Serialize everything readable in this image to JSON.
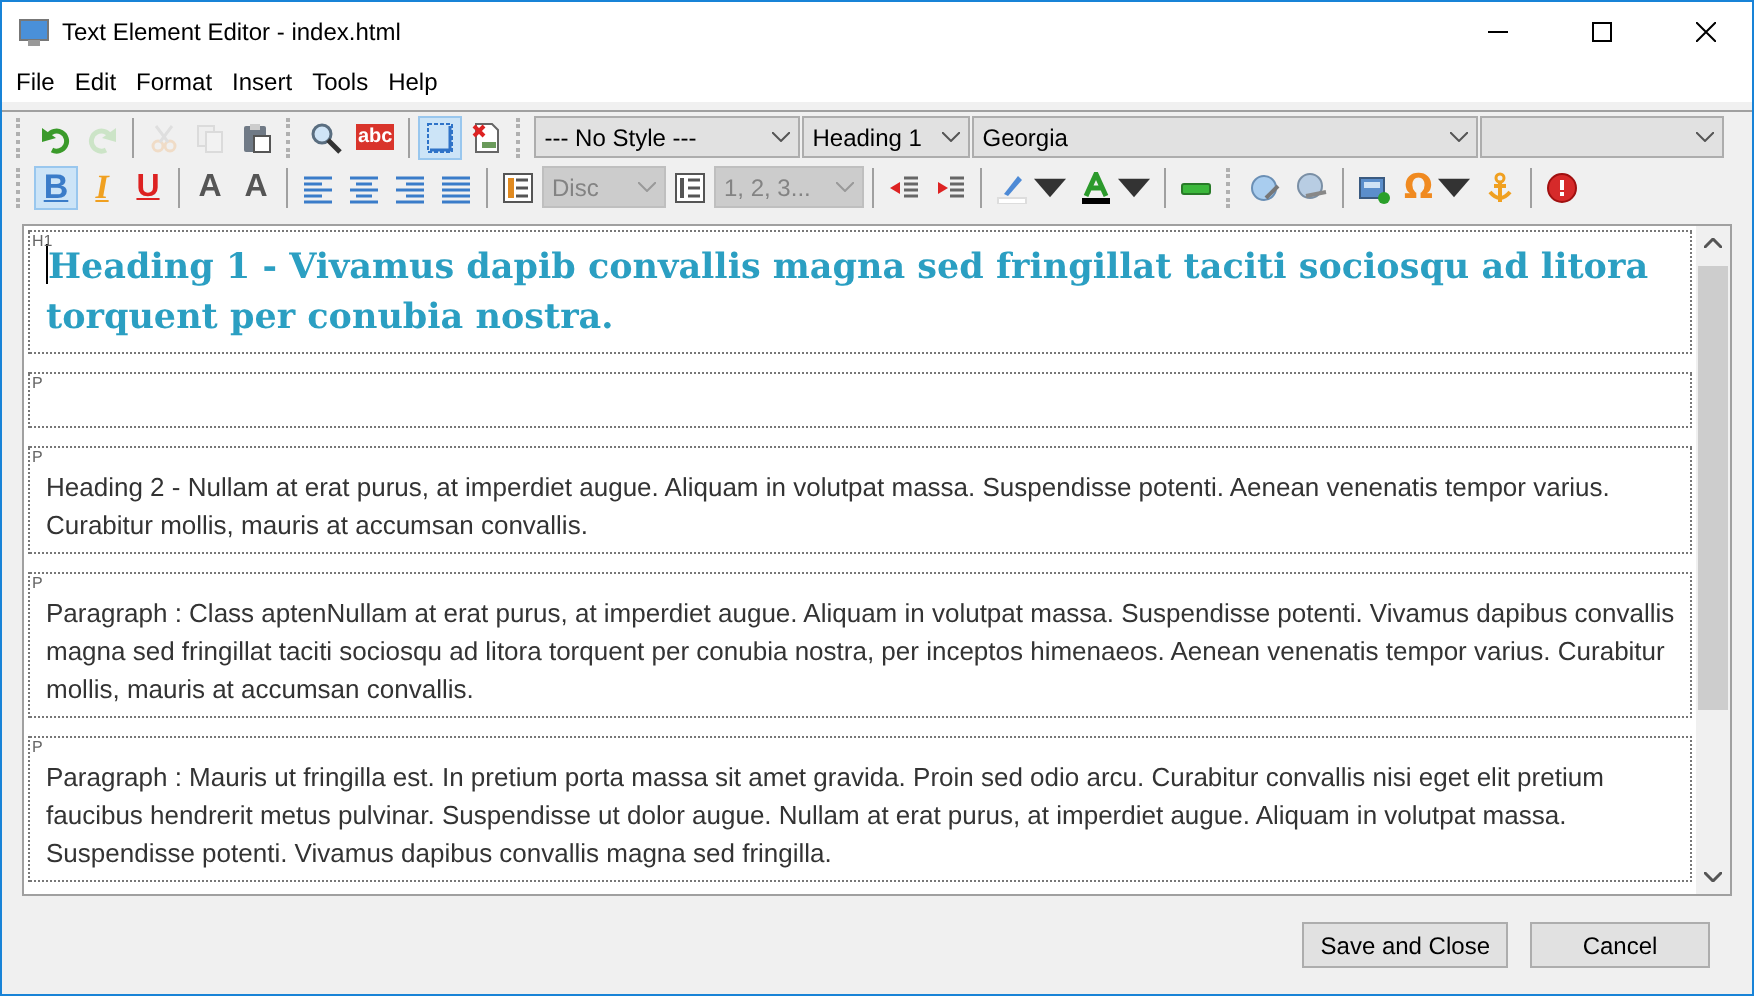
{
  "window": {
    "title": "Text Element Editor - index.html"
  },
  "menu": [
    "File",
    "Edit",
    "Format",
    "Insert",
    "Tools",
    "Help"
  ],
  "toolbar_1": [
    {
      "kind": "grip"
    },
    {
      "kind": "button",
      "disabled": false,
      "selected": false
    },
    {
      "kind": "button",
      "disabled": true,
      "selected": false
    },
    {
      "kind": "separator"
    },
    {
      "kind": "button",
      "disabled": true,
      "selected": false
    },
    {
      "kind": "button",
      "disabled": true,
      "selected": false
    },
    {
      "kind": "button",
      "disabled": false,
      "selected": false
    },
    {
      "kind": "grip"
    },
    {
      "kind": "button",
      "disabled": false,
      "selected": false
    },
    {
      "kind": "button",
      "disabled": false,
      "selected": false,
      "glyph": "abc"
    },
    {
      "kind": "separator"
    },
    {
      "kind": "button",
      "disabled": false,
      "selected": true
    },
    {
      "kind": "button",
      "disabled": false,
      "selected": false
    },
    {
      "kind": "grip"
    },
    {
      "kind": "dropdown",
      "value": "--- No Style ---",
      "disabled": false
    },
    {
      "kind": "dropdown",
      "value": "Heading 1",
      "disabled": false
    },
    {
      "kind": "dropdown",
      "value": "Georgia",
      "disabled": false
    },
    {
      "kind": "dropdown",
      "disabled": false
    }
  ],
  "toolbar_2": [
    {
      "kind": "grip"
    },
    {
      "kind": "button",
      "disabled": false,
      "selected": true,
      "glyph": "B"
    },
    {
      "kind": "button",
      "disabled": false,
      "selected": false,
      "glyph": "I"
    },
    {
      "kind": "button",
      "disabled": false,
      "selected": false,
      "glyph": "U"
    },
    {
      "kind": "separator"
    },
    {
      "kind": "button",
      "disabled": false,
      "selected": false,
      "glyph": "A"
    },
    {
      "kind": "button",
      "disabled": false,
      "selected": false,
      "glyph": "A"
    },
    {
      "kind": "separator"
    },
    {
      "kind": "button",
      "disabled": false,
      "selected": false
    },
    {
      "kind": "button",
      "disabled": false,
      "selected": false
    },
    {
      "kind": "button",
      "disabled": false,
      "selected": false
    },
    {
      "kind": "button",
      "disabled": false,
      "selected": false
    },
    {
      "kind": "separator"
    },
    {
      "kind": "button",
      "disabled": false,
      "selected": false
    },
    {
      "kind": "dropdown",
      "value": "Disc",
      "disabled": true
    },
    {
      "kind": "button",
      "disabled": false,
      "selected": false
    },
    {
      "kind": "dropdown",
      "value": "1, 2, 3...",
      "disabled": true
    },
    {
      "kind": "separator"
    },
    {
      "kind": "button",
      "disabled": false,
      "selected": false
    },
    {
      "kind": "button",
      "disabled": false,
      "selected": false
    },
    {
      "kind": "separator"
    },
    {
      "kind": "menubutton",
      "disabled": false
    },
    {
      "kind": "menubutton",
      "disabled": false
    },
    {
      "kind": "separator"
    },
    {
      "kind": "button",
      "disabled": false,
      "selected": false
    },
    {
      "kind": "grip"
    },
    {
      "kind": "button",
      "disabled": false,
      "selected": false
    },
    {
      "kind": "button",
      "disabled": false,
      "selected": false
    },
    {
      "kind": "separator"
    },
    {
      "kind": "button",
      "disabled": false,
      "selected": false
    },
    {
      "kind": "menubutton",
      "disabled": false,
      "glyph": "Ω"
    },
    {
      "kind": "button",
      "disabled": false,
      "selected": false
    },
    {
      "kind": "separator"
    },
    {
      "kind": "button",
      "disabled": false,
      "selected": false
    }
  ],
  "blocks": [
    {
      "tag": "H1",
      "kind": "heading",
      "text": "Heading 1 - Vivamus dapib convallis magna sed fringillat taciti sociosqu ad litora torquent per conubia nostra."
    },
    {
      "tag": "P"
    },
    {
      "tag": "P",
      "kind": "paragraph",
      "text": "Heading 2 - Nullam at erat purus, at imperdiet augue. Aliquam in volutpat massa. Suspendisse potenti. Aenean venenatis tempor varius. Curabitur mollis, mauris at accumsan convallis."
    },
    {
      "tag": "P",
      "kind": "paragraph",
      "text": "Paragraph : Class aptenNullam at erat purus, at imperdiet augue. Aliquam in volutpat massa. Suspendisse potenti. Vivamus dapibus convallis magna sed fringillat taciti sociosqu ad litora torquent per conubia nostra, per inceptos himenaeos. Aenean venenatis tempor varius. Curabitur mollis, mauris at accumsan convallis."
    },
    {
      "tag": "P",
      "kind": "paragraph",
      "text": "Paragraph : Mauris ut fringilla est. In pretium porta massa sit amet gravida. Proin sed odio arcu. Curabitur convallis nisi eget elit pretium faucibus hendrerit metus pulvinar. Suspendisse ut dolor augue. Nullam at erat purus, at imperdiet augue. Aliquam in volutpat massa. Suspendisse potenti. Vivamus dapibus convallis magna sed fringilla."
    }
  ],
  "buttons": [
    "Save and Close",
    "Cancel"
  ]
}
